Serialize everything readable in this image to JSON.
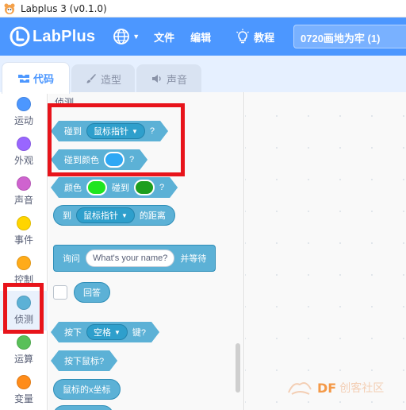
{
  "window": {
    "title": "Labplus 3 (v0.1.0)"
  },
  "menubar": {
    "logo_text": "LabPlus",
    "file": "文件",
    "edit": "编辑",
    "tutorial": "教程",
    "project_title": "0720画地为牢 (1)"
  },
  "tabs": {
    "code": "代码",
    "costume": "造型",
    "sound": "声音"
  },
  "categories": [
    {
      "label": "运动",
      "color": "#4c97ff"
    },
    {
      "label": "外观",
      "color": "#9966ff"
    },
    {
      "label": "声音",
      "color": "#cf63cf"
    },
    {
      "label": "事件",
      "color": "#ffd500"
    },
    {
      "label": "控制",
      "color": "#ffab19"
    },
    {
      "label": "侦测",
      "color": "#5cb1d6"
    },
    {
      "label": "运算",
      "color": "#59c059"
    },
    {
      "label": "变量",
      "color": "#ff8c1a"
    }
  ],
  "palette": {
    "section_title": "侦测",
    "touching": {
      "prefix": "碰到",
      "menu": "鼠标指针",
      "suffix": "?"
    },
    "touching_color": {
      "prefix": "碰到颜色",
      "suffix": "?",
      "swatch": "#2ea8f5"
    },
    "color_touching_color": {
      "prefix": "颜色",
      "middle": "碰到",
      "suffix": "?",
      "swatch1": "#1fe51f",
      "swatch2": "#1e9e1e"
    },
    "distance_to": {
      "prefix": "到",
      "menu": "鼠标指针",
      "suffix": "的距离"
    },
    "ask": {
      "prefix": "询问",
      "input": "What's your name?",
      "suffix": "并等待"
    },
    "answer": "回答",
    "key_pressed": {
      "prefix": "按下",
      "menu": "空格",
      "suffix": "键?"
    },
    "mouse_down": "按下鼠标?",
    "mouse_x": "鼠标的x坐标"
  },
  "watermark": {
    "df": "DF",
    "rest": "创客社区"
  },
  "colors": {
    "accent": "#4c97ff",
    "sensing": "#5cb1d6",
    "annotation": "#e8141b"
  }
}
